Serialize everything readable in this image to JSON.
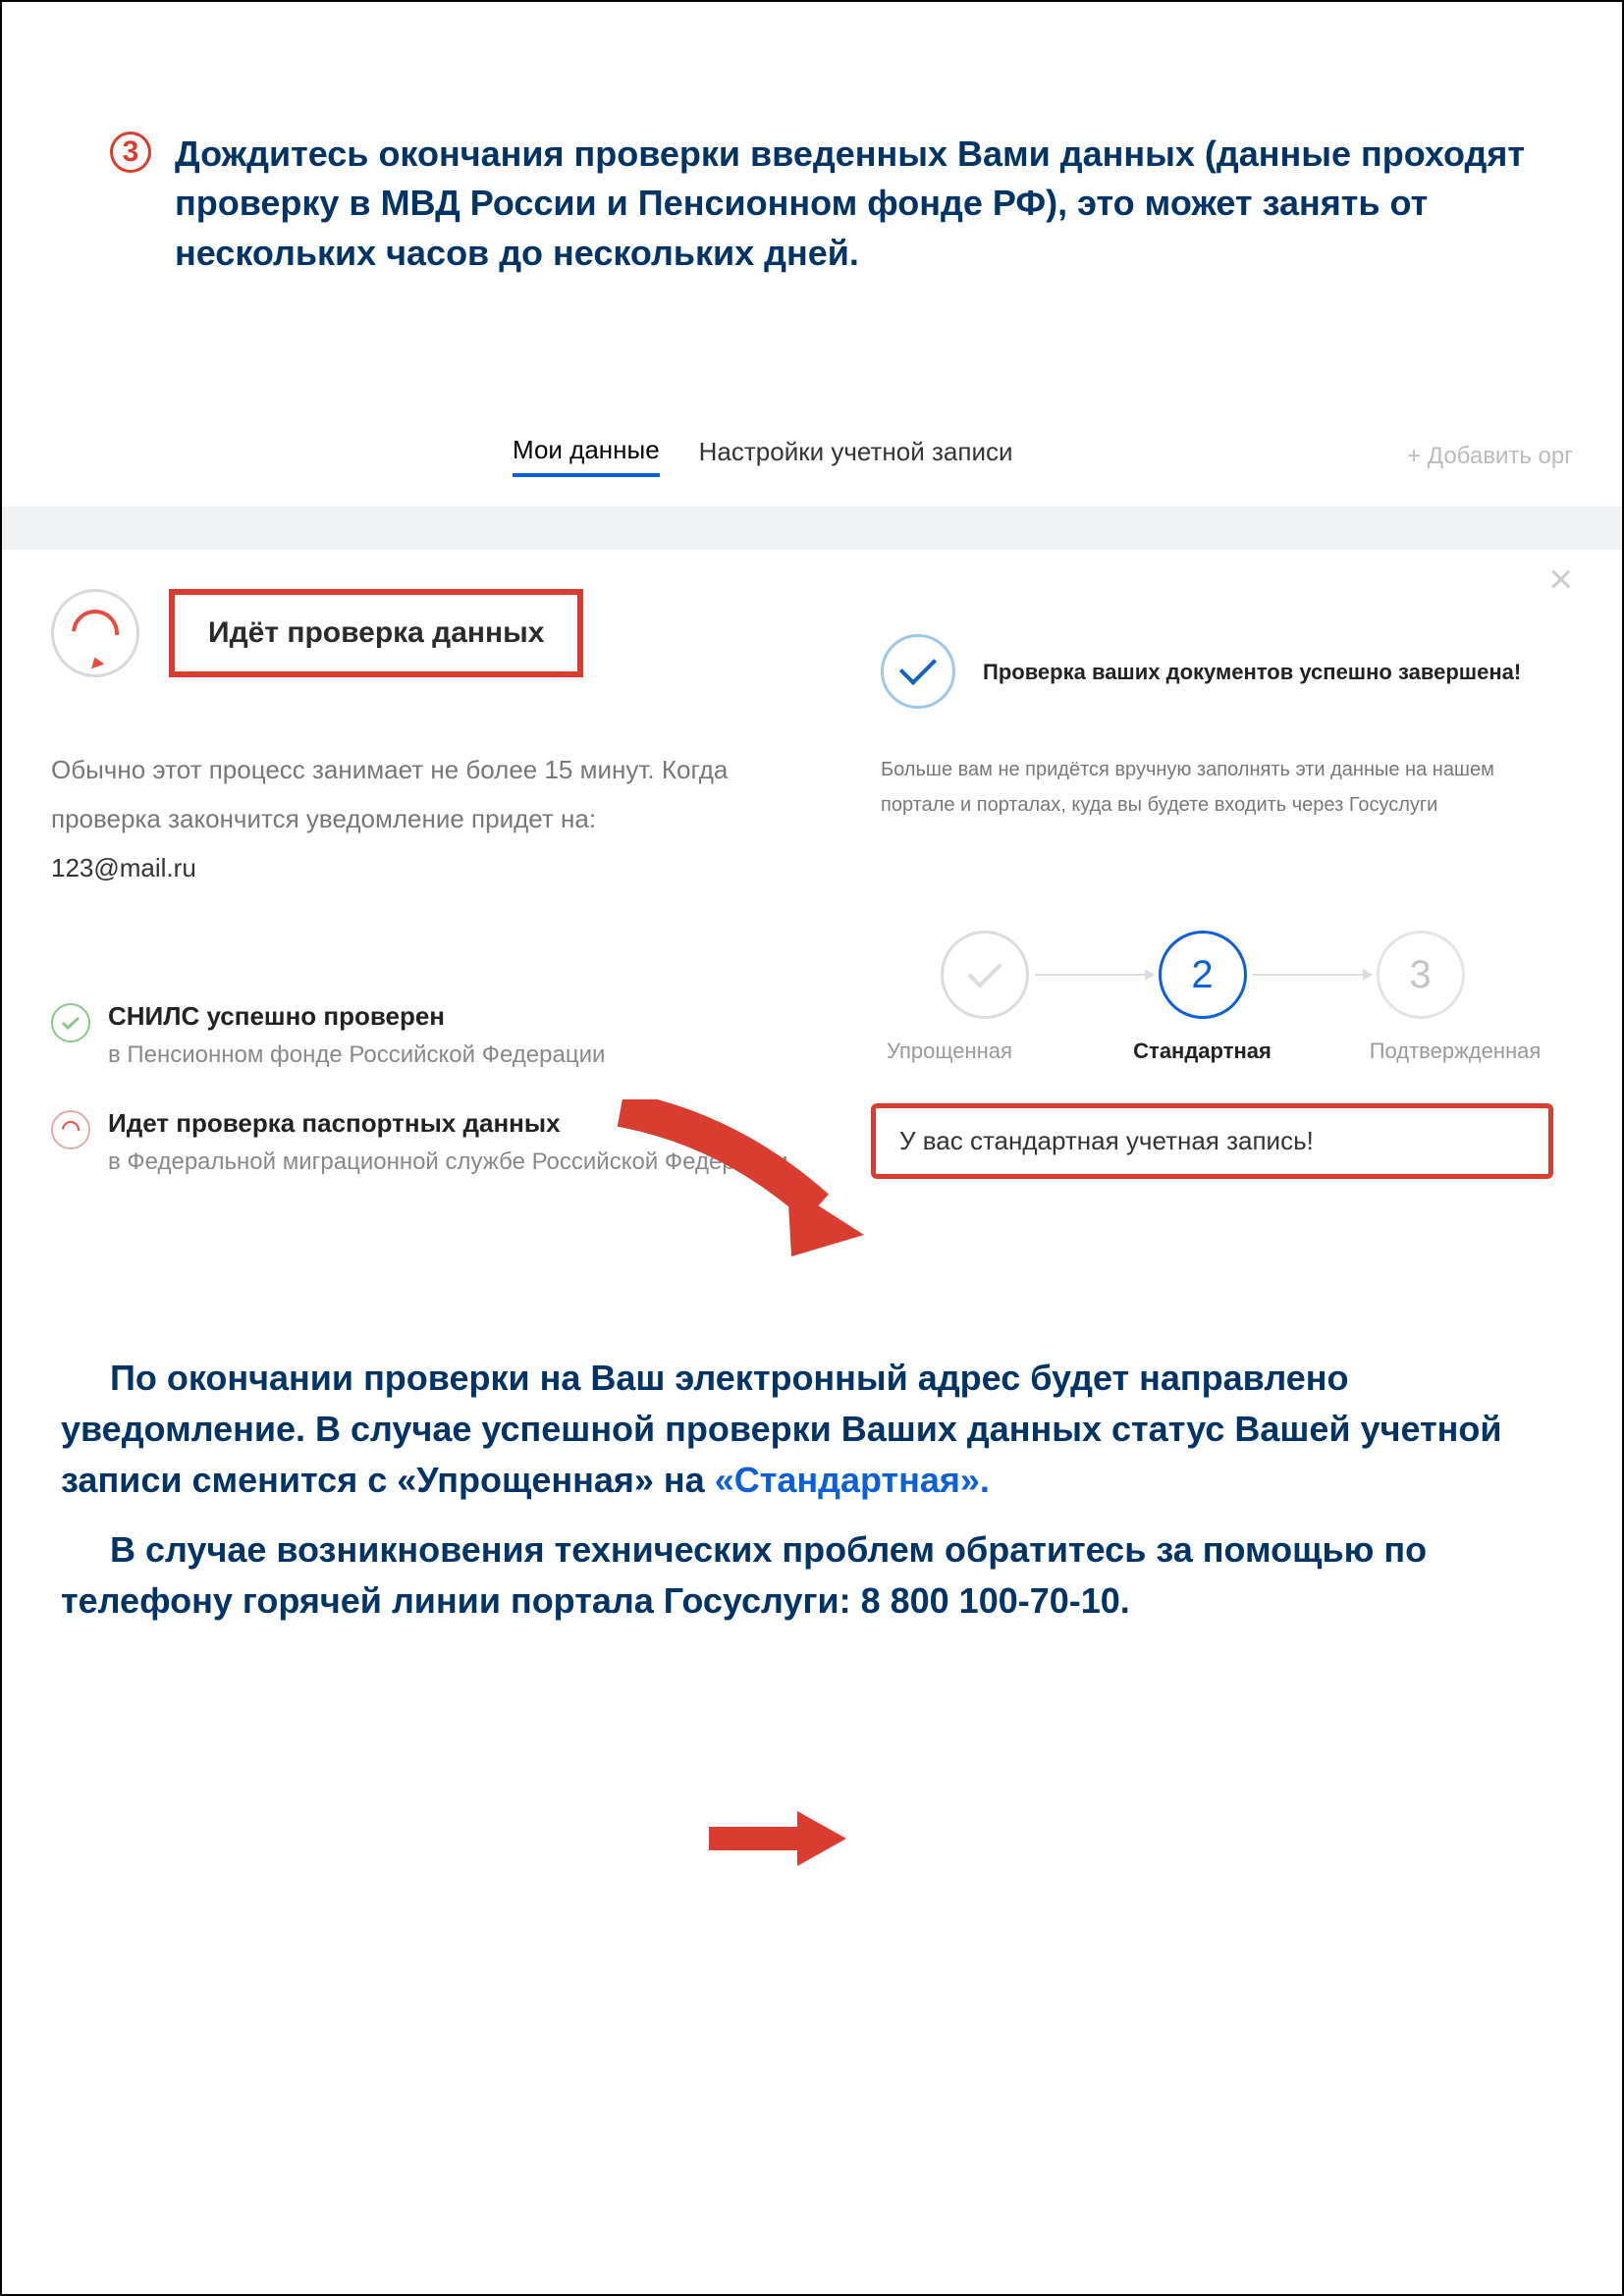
{
  "step": {
    "number": "3",
    "text": "Дождитесь окончания проверки введенных Вами данных (данные проходят проверку в МВД России и Пенсионном фонде РФ), это может занять от нескольких часов до нескольких дней."
  },
  "tabs": {
    "my_data": "Мои данные",
    "settings": "Настройки учетной записи",
    "add_org": "+ Добавить орг"
  },
  "left": {
    "checking_title": "Идёт проверка данных",
    "desc": "Обычно этот процесс занимает не более 15 минут. Когда проверка закончится уведомление придет на:",
    "email": "123@mail.ru",
    "snils_title": "СНИЛС успешно проверен",
    "snils_sub": "в Пенсионном фонде Российской Федерации",
    "passport_title": "Идет проверка паспортных данных",
    "passport_sub": "в Федеральной миграционной службе Российской Федерации"
  },
  "right": {
    "success_title": "Проверка ваших документов успешно завершена!",
    "success_desc": "Больше вам не придётся вручную заполнять эти данные на нашем портале и порталах, куда вы будете входить через Госуслуги",
    "step2_num": "2",
    "step3_num": "3",
    "label1": "Упрощенная",
    "label2": "Стандартная",
    "label3": "Подтвержденная",
    "status": "У вас стандартная учетная запись!"
  },
  "bottom": {
    "p1a": "По окончании проверки на Ваш электронный адрес будет направлено уведомление. В случае успешной проверки Ваших данных статус Вашей учетной записи сменится с «Упрощенная» на ",
    "p1b": "«Стандартная».",
    "p2a": "В случае возникновения технических проблем обратитесь за помощью по телефону горячей линии портала ",
    "p2b": "Госуслуги: 8 800 100-70-10."
  }
}
